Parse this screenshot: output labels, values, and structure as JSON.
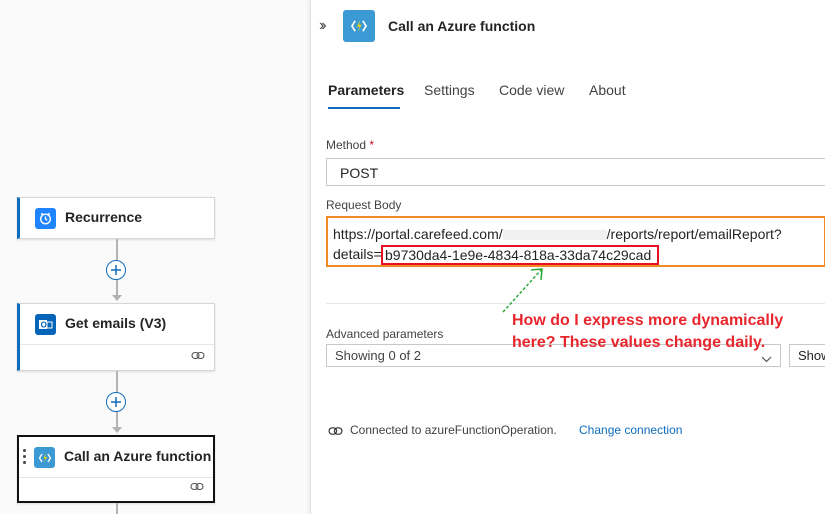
{
  "canvas": {
    "nodes": [
      {
        "label": "Recurrence",
        "icon": "clock-icon",
        "color": "#1f85ff"
      },
      {
        "label": "Get emails (V3)",
        "icon": "outlook-icon",
        "color": "#0364b8"
      },
      {
        "label": "Call an Azure function",
        "icon": "azure-function-icon",
        "color": "#3b99d4"
      }
    ]
  },
  "panel": {
    "title": "Call an Azure function",
    "tabs": [
      {
        "label": "Parameters",
        "active": true
      },
      {
        "label": "Settings"
      },
      {
        "label": "Code view"
      },
      {
        "label": "About"
      }
    ],
    "method": {
      "label": "Method",
      "required_mark": "*",
      "value": "POST"
    },
    "request_body": {
      "label": "Request Body",
      "line1_start": "https://portal.carefeed.com/",
      "line1_end": "/reports/report/emailReport?",
      "line2_prefix": "details=",
      "guid": "b9730da4-1e9e-4834-818a-33da74c29cad"
    },
    "advanced": {
      "label": "Advanced parameters",
      "select_value": "Showing 0 of 2",
      "show_button": "Show"
    },
    "connection": {
      "text": "Connected to azureFunctionOperation.",
      "change_link": "Change connection"
    }
  },
  "annotation": {
    "text": "How do I express more dynamically here? These values change daily.",
    "color": "#e8262e"
  },
  "colors": {
    "accent": "#0f6cbd",
    "highlight_orange": "#f08a24",
    "highlight_red": "#e81123"
  }
}
